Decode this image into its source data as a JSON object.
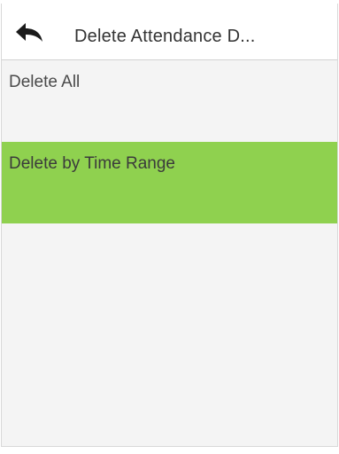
{
  "header": {
    "back_icon": "back-arrow-icon",
    "title": "Delete Attendance D..."
  },
  "menu": {
    "items": [
      {
        "label": "Delete All",
        "selected": false
      },
      {
        "label": "Delete by Time Range",
        "selected": true
      }
    ]
  },
  "colors": {
    "background": "#f4f4f4",
    "header_bg": "#ffffff",
    "selected_bg": "#8fd14f",
    "text": "#4a4a4a"
  }
}
